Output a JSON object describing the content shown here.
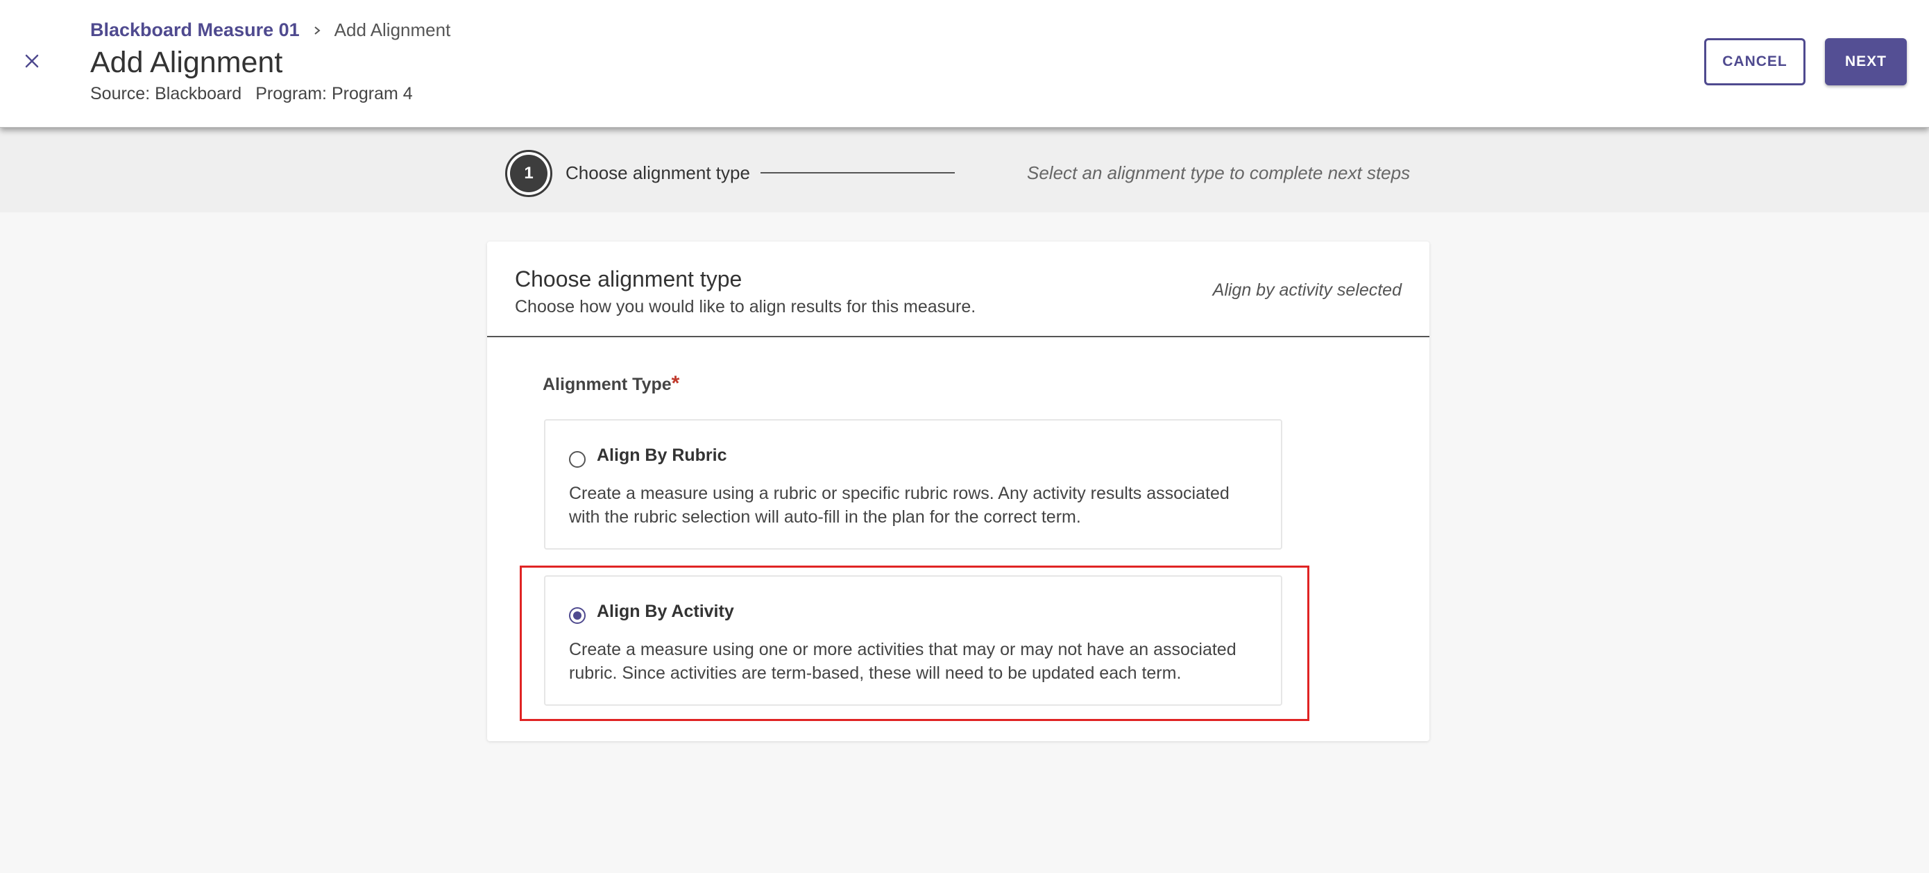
{
  "header": {
    "breadcrumb": {
      "parent": "Blackboard Measure 01",
      "current": "Add Alignment"
    },
    "title": "Add Alignment",
    "source": "Source: Blackboard",
    "program": "Program: Program 4",
    "cancel_label": "CANCEL",
    "next_label": "NEXT"
  },
  "stepper": {
    "step_number": "1",
    "step_label": "Choose alignment type",
    "hint": "Select an alignment type to complete next steps"
  },
  "card": {
    "title": "Choose alignment type",
    "subtitle": "Choose how you would like to align results for this measure.",
    "status": "Align by activity selected",
    "field_label": "Alignment Type",
    "required_mark": "*",
    "options": [
      {
        "title": "Align By Rubric",
        "description": "Create a measure using a rubric or specific rubric rows. Any activity results associated with the rubric selection will auto-fill in the plan for the correct term.",
        "selected": false
      },
      {
        "title": "Align By Activity",
        "description": "Create a measure using one or more activities that may or may not have an associated rubric. Since activities are term-based, these will need to be updated each term.",
        "selected": true
      }
    ]
  },
  "colors": {
    "accent": "#4f4a8f",
    "highlight": "#e02424"
  },
  "icons": {
    "close": "close-icon",
    "breadcrumb_separator": "chevron-right-icon",
    "radio_unchecked": "radio-unchecked-icon",
    "radio_checked": "radio-checked-icon"
  }
}
